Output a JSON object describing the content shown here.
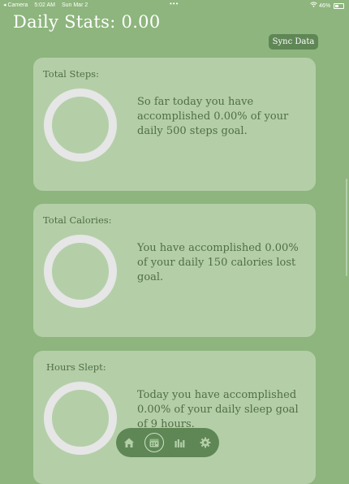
{
  "status_bar": {
    "back_app": "◂ Camera",
    "time": "5:02 AM",
    "date": "Sun Mar 2",
    "battery": "46%"
  },
  "header": {
    "title": "Daily Stats: 0.00",
    "sync_label": "Sync Data"
  },
  "cards": [
    {
      "title": "Total Steps:",
      "text": "So far today you have accomplished 0.00% of your daily 500 steps goal.",
      "progress_percent": 0
    },
    {
      "title": "Total Calories:",
      "text": "You have accomplished 0.00% of your daily 150 calories lost goal.",
      "progress_percent": 0
    },
    {
      "title": "Hours Slept:",
      "text": "Today you have accomplished 0.00% of your daily sleep goal of 9 hours.",
      "progress_percent": 0
    }
  ],
  "tab_bar": {
    "tabs": [
      {
        "icon": "home-icon"
      },
      {
        "icon": "calendar-icon",
        "active": true
      },
      {
        "icon": "bar-chart-icon"
      },
      {
        "icon": "gear-icon"
      }
    ]
  },
  "colors": {
    "background": "#8db57d",
    "card": "#b4cfa8",
    "text": "#4f6e47",
    "accent": "#5f8756",
    "ring": "#e6e6e6"
  }
}
